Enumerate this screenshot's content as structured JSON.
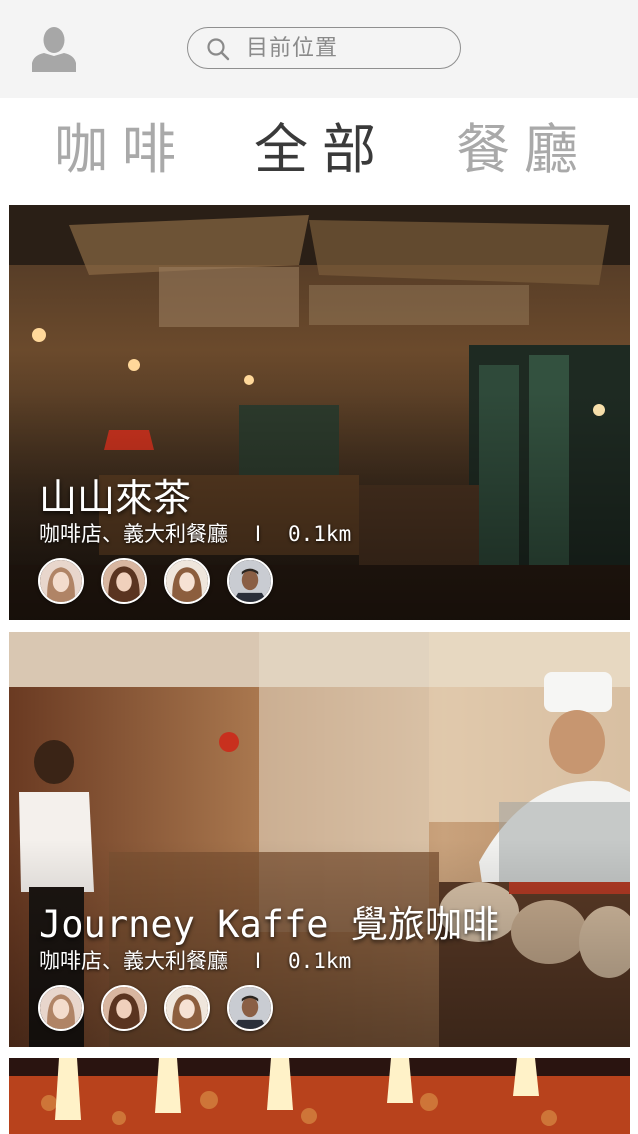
{
  "header": {
    "profile_icon": "user-icon",
    "search": {
      "icon": "search-icon",
      "placeholder": "目前位置"
    }
  },
  "tabs": [
    {
      "label": "咖啡",
      "active": false
    },
    {
      "label": "全部",
      "active": true
    },
    {
      "label": "餐廳",
      "active": false
    }
  ],
  "cards": [
    {
      "title": "山山來茶",
      "category": "咖啡店、義大利餐廳",
      "separator": "I",
      "distance": "0.1km",
      "friends": [
        "friend-avatar",
        "friend-avatar",
        "friend-avatar",
        "friend-avatar"
      ]
    },
    {
      "title": "Journey Kaffe 覺旅咖啡",
      "category": "咖啡店、義大利餐廳",
      "separator": "I",
      "distance": "0.1km",
      "friends": [
        "friend-avatar",
        "friend-avatar",
        "friend-avatar",
        "friend-avatar"
      ]
    }
  ],
  "colors": {
    "header_bg": "#f4f4f4",
    "tab_active": "#3a3a3a",
    "tab_inactive": "#a9a9a9",
    "text_on_image": "#ffffff"
  }
}
